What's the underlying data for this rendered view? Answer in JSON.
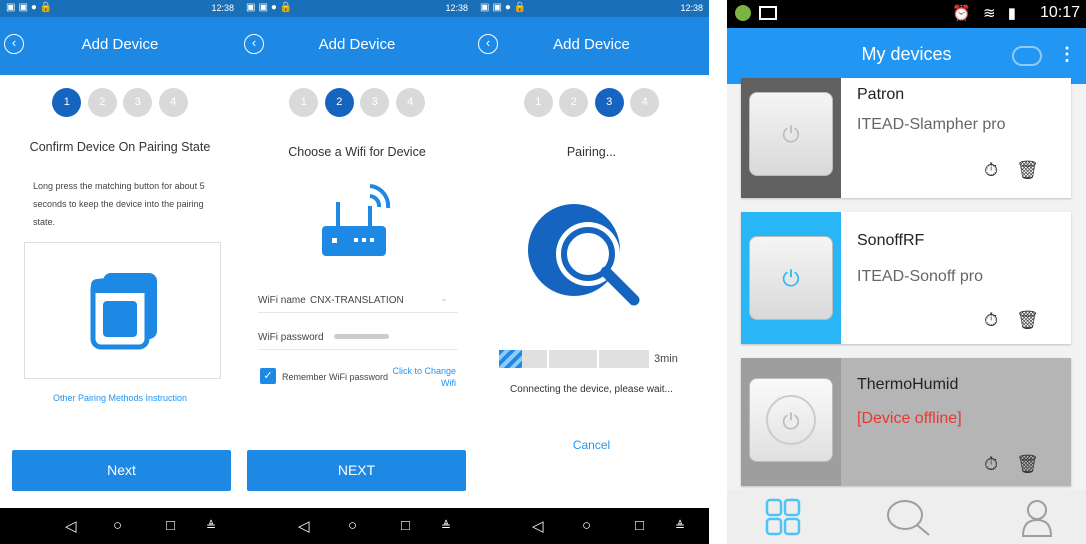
{
  "screen1": {
    "status_time": "12:38",
    "title": "Add Device",
    "steps": [
      "1",
      "2",
      "3",
      "4"
    ],
    "active_step": 1,
    "heading": "Confirm Device On Pairing State",
    "description": "Long press the matching button for about 5 seconds to keep the device into the pairing state.",
    "link": "Other Pairing Methods Instruction",
    "button": "Next"
  },
  "screen2": {
    "status_time": "12:38",
    "title": "Add Device",
    "steps": [
      "1",
      "2",
      "3",
      "4"
    ],
    "active_step": 2,
    "heading": "Choose a Wifi for Device",
    "wifi_name_label": "WiFi name",
    "wifi_name_value": "CNX-TRANSLATION",
    "wifi_password_label": "WiFi password",
    "remember_label": "Remember WiFi password",
    "change_link": "Click to Change Wifi",
    "button": "NEXT"
  },
  "screen3": {
    "status_time": "12:38",
    "title": "Add Device",
    "steps": [
      "1",
      "2",
      "3",
      "4"
    ],
    "active_step": 3,
    "heading": "Pairing...",
    "remaining": "3min",
    "status": "Connecting the device, please wait...",
    "cancel": "Cancel",
    "progress": 0.15
  },
  "screen4": {
    "time": "10:17",
    "title": "My devices",
    "devices": [
      {
        "name": "Patron",
        "type": "ITEAD-Slampher pro",
        "offline": false
      },
      {
        "name": "SonoffRF",
        "type": "ITEAD-Sonoff pro",
        "offline": false
      },
      {
        "name": "ThermoHumid",
        "type": "[Device offline]",
        "offline": true
      }
    ],
    "nav_icons": [
      "grid-icon",
      "search-icon",
      "user-icon"
    ]
  },
  "colors": {
    "primary": "#1e88e5",
    "active_step": "#1565c0",
    "inactive_step": "#d9d9d9",
    "link": "#2196f3",
    "offline": "#e53935",
    "sonoff_bg": "#29b6f6"
  }
}
